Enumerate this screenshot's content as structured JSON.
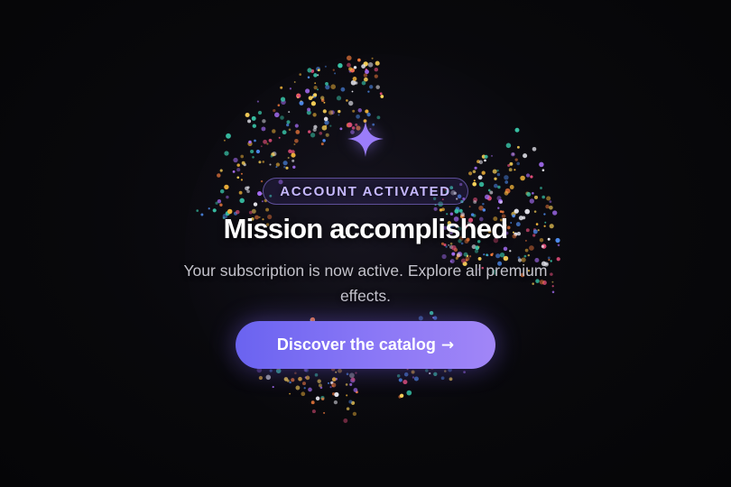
{
  "badge": {
    "label": "ACCOUNT ACTIVATED"
  },
  "title": "Mission accomplished",
  "subtitle": "Your subscription is now active. Explore all premium effects.",
  "cta": {
    "label": "Discover the catalog",
    "arrow": "→"
  },
  "icons": {
    "hero": "sparkle-icon",
    "cta_arrow": "arrow-right-icon"
  },
  "colors": {
    "background": "#07070a",
    "accent": "#8b78f6",
    "badge_text": "#c6b8ff",
    "sparkle": "#9b7dfa",
    "particles": [
      "#f2b53a",
      "#4f8df0",
      "#e8e8f0",
      "#a46cf2",
      "#e34e7a",
      "#39c5a8",
      "#f07a3c",
      "#ffd65a"
    ]
  }
}
